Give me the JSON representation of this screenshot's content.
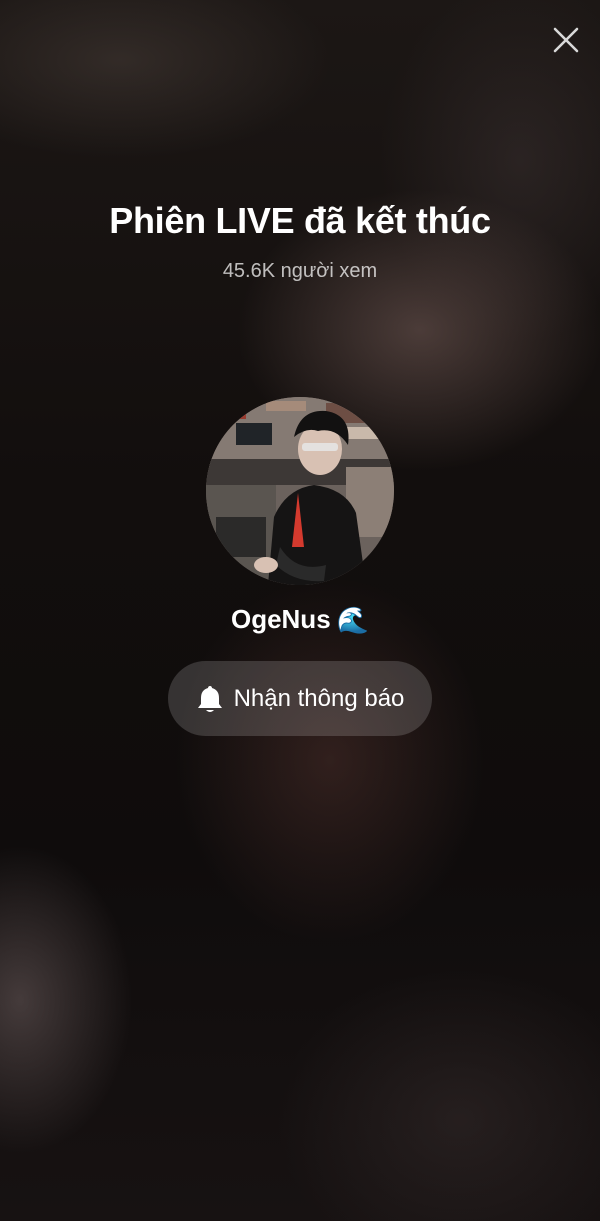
{
  "header": {
    "close_icon": "close-icon"
  },
  "live_end": {
    "title": "Phiên LIVE đã kết thúc",
    "viewers": "45.6K người xem"
  },
  "host": {
    "username": "OgeNus",
    "emoji": "🌊"
  },
  "actions": {
    "notify_label": "Nhận thông báo",
    "notify_icon": "bell-icon"
  }
}
